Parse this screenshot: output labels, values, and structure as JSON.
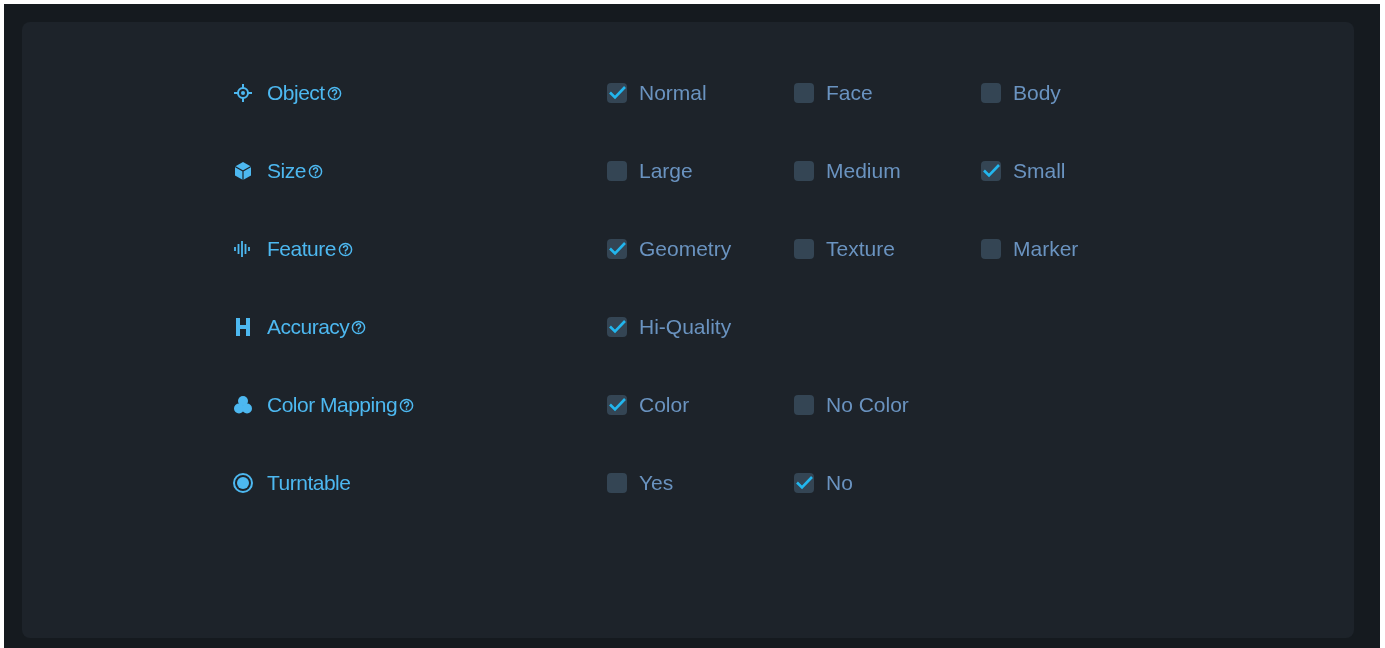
{
  "settings": [
    {
      "kind": "target",
      "label": "Object",
      "help": true,
      "options": [
        {
          "label": "Normal",
          "checked": true
        },
        {
          "label": "Face",
          "checked": false
        },
        {
          "label": "Body",
          "checked": false
        }
      ]
    },
    {
      "kind": "cube",
      "label": "Size",
      "help": true,
      "options": [
        {
          "label": "Large",
          "checked": false
        },
        {
          "label": "Medium",
          "checked": false
        },
        {
          "label": "Small",
          "checked": true
        }
      ]
    },
    {
      "kind": "wave",
      "label": "Feature",
      "help": true,
      "options": [
        {
          "label": "Geometry",
          "checked": true
        },
        {
          "label": "Texture",
          "checked": false
        },
        {
          "label": "Marker",
          "checked": false
        }
      ]
    },
    {
      "kind": "letter",
      "label": "Accuracy",
      "help": true,
      "options": [
        {
          "label": "Hi-Quality",
          "checked": true
        }
      ]
    },
    {
      "kind": "rgb",
      "label": "Color Mapping",
      "help": true,
      "options": [
        {
          "label": "Color",
          "checked": true
        },
        {
          "label": "No Color",
          "checked": false
        }
      ]
    },
    {
      "kind": "ring",
      "label": "Turntable",
      "help": false,
      "options": [
        {
          "label": "Yes",
          "checked": false
        },
        {
          "label": "No",
          "checked": true
        }
      ]
    }
  ]
}
